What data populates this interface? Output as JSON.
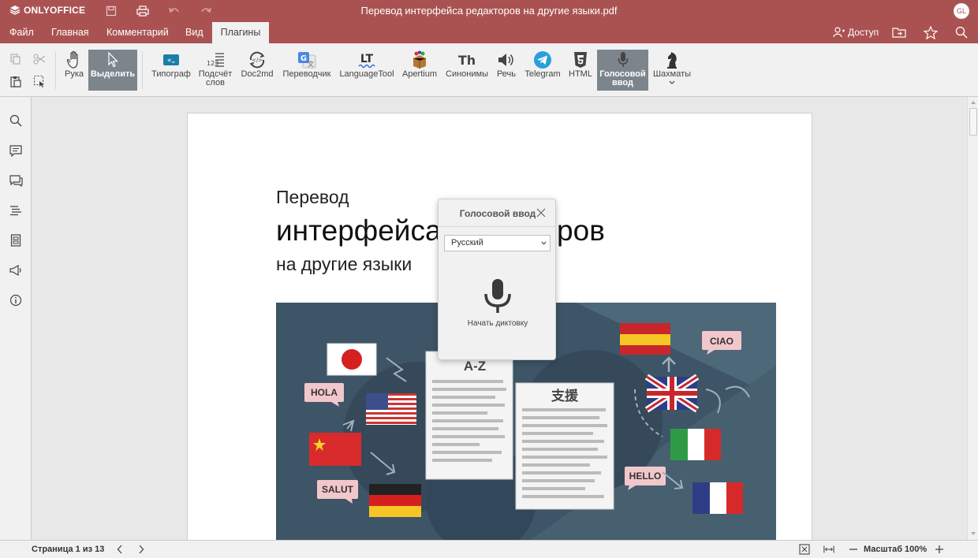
{
  "app": {
    "brand": "ONLYOFFICE",
    "document_title": "Перевод интерфейса редакторов на другие языки.pdf",
    "user_initials": "GL",
    "access_label": "Доступ",
    "accent_color": "#aa5252"
  },
  "menu": {
    "tabs": [
      {
        "label": "Файл"
      },
      {
        "label": "Главная"
      },
      {
        "label": "Комментарий"
      },
      {
        "label": "Вид"
      },
      {
        "label": "Плагины"
      }
    ],
    "active_tab": "Плагины"
  },
  "toolbar": {
    "hand": "Рука",
    "select": "Выделить",
    "typograf": "Типограф",
    "wordcount_1": "Подсчёт",
    "wordcount_2": "слов",
    "doc2md": "Doc2md",
    "translator": "Переводчик",
    "languagetool": "LanguageTool",
    "apertium": "Apertium",
    "synonyms": "Синонимы",
    "speech": "Речь",
    "telegram": "Telegram",
    "html": "HTML",
    "voice_1": "Голосовой",
    "voice_2": "ввод",
    "chess": "Шахматы",
    "icon_letters": {
      "wordcount": "123",
      "languagetool": "LT",
      "synonyms": "Th",
      "translator": "G"
    }
  },
  "document": {
    "heading_line1": "Перевод",
    "heading_line2": "интерфейса редакторов",
    "heading_line3": "на другие языки",
    "illustration": {
      "bubbles": [
        "HOLA",
        "CIAO",
        "SALUT",
        "HELLO"
      ],
      "card_left_title": "A-Z",
      "card_right_title": "支援"
    }
  },
  "voice_popup": {
    "title": "Голосовой ввод",
    "language": "Русский",
    "start_label": "Начать диктовку"
  },
  "status": {
    "page_info": "Страница 1 из 13",
    "zoom_label": "Масштаб 100%"
  }
}
